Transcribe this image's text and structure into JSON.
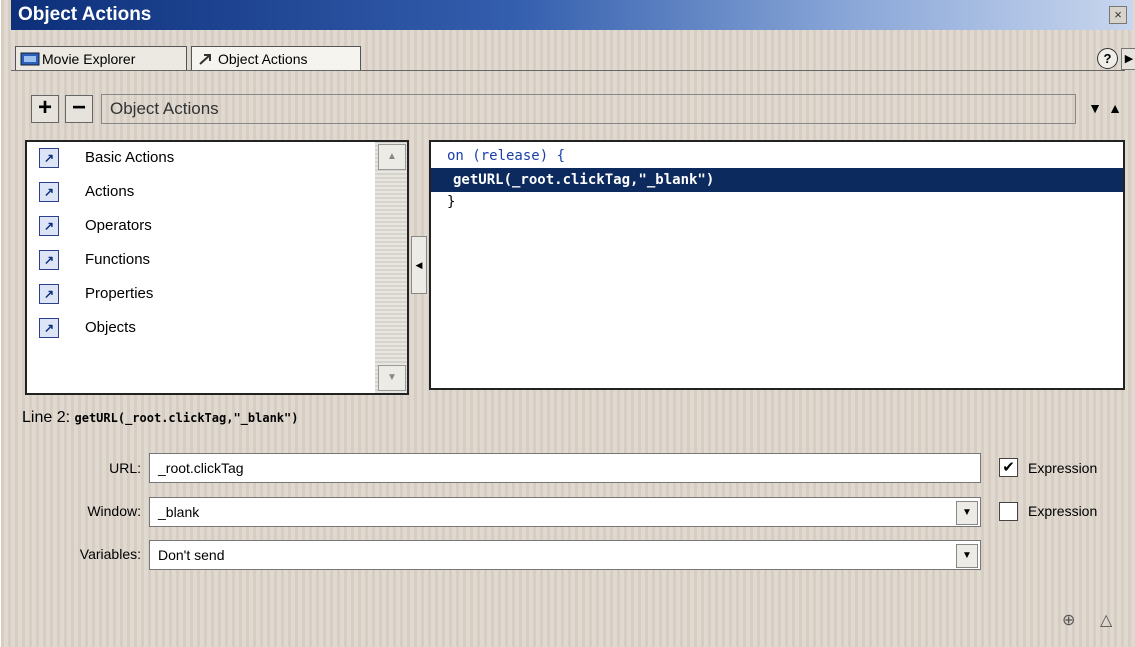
{
  "window": {
    "title": "Object Actions"
  },
  "tabs": [
    {
      "label": "Movie Explorer"
    },
    {
      "label": "Object Actions"
    }
  ],
  "toolbar": {
    "add_label": "+",
    "remove_label": "−",
    "dropdown_value": "Object Actions"
  },
  "categories": [
    {
      "label": "Basic Actions"
    },
    {
      "label": "Actions"
    },
    {
      "label": "Operators"
    },
    {
      "label": "Functions"
    },
    {
      "label": "Properties"
    },
    {
      "label": "Objects"
    }
  ],
  "script": {
    "line1_keyword": "on",
    "line1_rest": " (release) {",
    "line2": "getURL(_root.clickTag,\"_blank\")",
    "line3": "}"
  },
  "status": {
    "prefix": "Line 2:",
    "code": "getURL(_root.clickTag,\"_blank\")"
  },
  "params": {
    "url_label": "URL:",
    "url_value": "_root.clickTag",
    "url_expression_label": "Expression",
    "url_expression_checked": true,
    "window_label": "Window:",
    "window_value": "_blank",
    "window_expression_label": "Expression",
    "window_expression_checked": false,
    "variables_label": "Variables:",
    "variables_value": "Don't send"
  },
  "colors": {
    "titlebar_start": "#0d2f7a",
    "selection": "#0c2a5e",
    "keyword": "#1a3fa8"
  }
}
